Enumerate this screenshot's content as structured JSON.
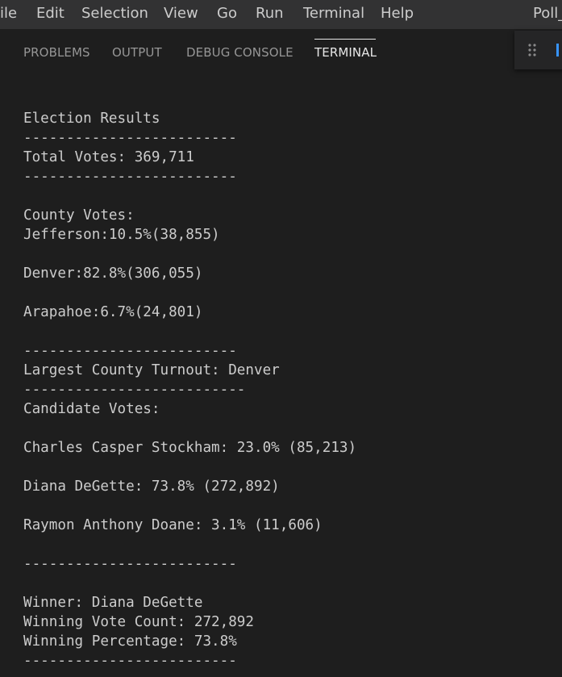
{
  "menubar": {
    "items": [
      "ile",
      "Edit",
      "Selection",
      "View",
      "Go",
      "Run",
      "Terminal",
      "Help"
    ],
    "window_title": "Poll_"
  },
  "panel": {
    "tabs": [
      "PROBLEMS",
      "OUTPUT",
      "DEBUG CONSOLE",
      "TERMINAL"
    ],
    "active_tab": "TERMINAL"
  },
  "terminal": {
    "lines": [
      "Election Results",
      "-------------------------",
      "Total Votes: 369,711",
      "-------------------------",
      "",
      "County Votes:",
      "Jefferson:10.5%(38,855)",
      "",
      "Denver:82.8%(306,055)",
      "",
      "Arapahoe:6.7%(24,801)",
      "",
      "-------------------------",
      "Largest County Turnout: Denver",
      "--------------------------",
      "Candidate Votes:",
      "",
      "Charles Casper Stockham: 23.0% (85,213)",
      "",
      "Diana DeGette: 73.8% (272,892)",
      "",
      "Raymon Anthony Doane: 3.1% (11,606)",
      "",
      "-------------------------",
      "",
      "Winner: Diana DeGette",
      "Winning Vote Count: 272,892",
      "Winning Percentage: 73.8%",
      "-------------------------"
    ]
  },
  "colors": {
    "menubar_bg": "#323233",
    "panel_bg": "#1e1e1e",
    "terminal_text": "#cccccc",
    "inactive_tab": "#969696",
    "active_tab": "#e7e7e7",
    "accent": "#3794ff"
  }
}
